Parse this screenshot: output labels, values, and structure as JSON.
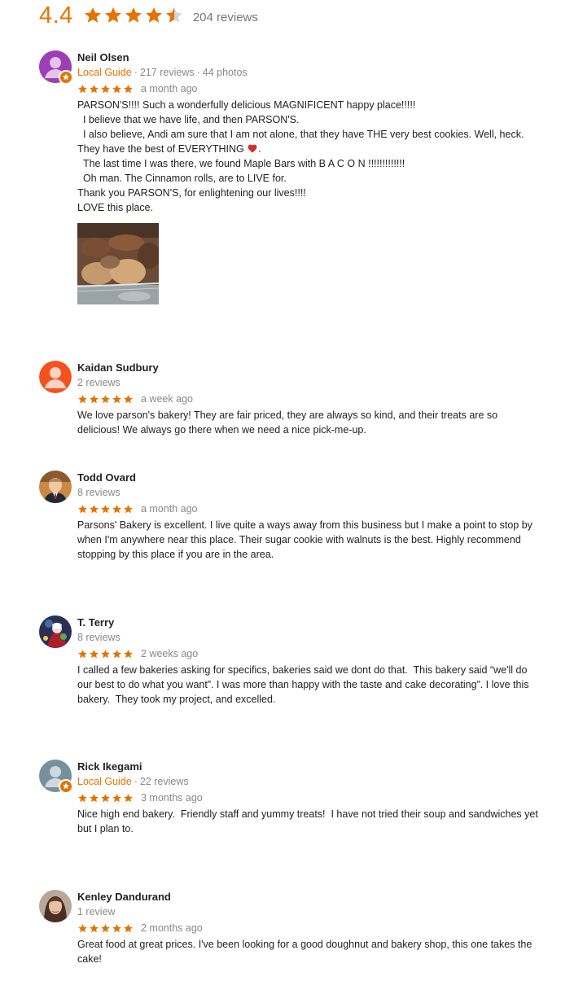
{
  "summary": {
    "score": "4.4",
    "rating": 4.4,
    "reviews_label": "204 reviews"
  },
  "colors": {
    "accent": "#e37400",
    "star": "#e37400",
    "star_empty": "#d5d5d5"
  },
  "reviews": [
    {
      "name": "Neil Olsen",
      "local_guide": "Local Guide",
      "reviews_count": "217 reviews",
      "photos_count": "44 photos",
      "stars": 5,
      "time": "a month ago",
      "text_lines": [
        "PARSON'S!!!! Such a wonderfully delicious MAGNIFICENT happy place!!!!!",
        "  I believe that we have life, and then PARSON'S.",
        "  I also believe, Andi am sure that I am not alone, that they have THE very best cookies. Well, heck.",
        "They have the best of EVERYTHING ",
        "  The last time I was there, we found Maple Bars with B A C O N !!!!!!!!!!!!!",
        "  Oh man. The Cinnamon rolls, are to LIVE for.",
        "Thank you PARSON'S, for enlightening our lives!!!!",
        "LOVE this place."
      ],
      "heart_icon": "heart-icon",
      "avatar_color": "#9c3fb5"
    },
    {
      "name": "Kaidan Sudbury",
      "reviews_count": "2 reviews",
      "stars": 5,
      "time": "a week ago",
      "text_lines": [
        "We love parson's bakery! They are fair priced, they are always so kind, and their treats are so",
        "delicious! We always go there when we need a nice pick-me-up."
      ],
      "avatar_color": "#f4511e"
    },
    {
      "name": "Todd Ovard",
      "reviews_count": "8 reviews",
      "stars": 5,
      "time": "a month ago",
      "text_lines": [
        "Parsons' Bakery is excellent. I live quite a ways away from this business but I make a point to stop by",
        "when I'm anywhere near this place. Their sugar cookie with walnuts is the best. Highly recommend",
        "stopping by this place if you are in the area."
      ]
    },
    {
      "name": "T. Terry",
      "reviews_count": "8 reviews",
      "stars": 5,
      "time": "2 weeks ago",
      "text_lines": [
        "I called a few bakeries asking for specifics, bakeries said we dont do that.  This bakery said “we'll do",
        "our best to do what you want”. I was more than happy with the taste and cake decorating”. I love this",
        "bakery.  They took my project, and excelled."
      ]
    },
    {
      "name": "Rick Ikegami",
      "local_guide": "Local Guide",
      "reviews_count": "22 reviews",
      "stars": 5,
      "time": "3 months ago",
      "text_lines": [
        "Nice high end bakery.  Friendly staff and yummy treats!  I have not tried their soup and sandwiches yet",
        "but I plan to."
      ],
      "avatar_color": "#78909c"
    },
    {
      "name": "Kenley Dandurand",
      "reviews_count": "1 review",
      "stars": 5,
      "time": "2 months ago",
      "text_lines": [
        "Great food at great prices. I've been looking for a good doughnut and bakery shop, this one takes the",
        "cake!"
      ]
    }
  ]
}
